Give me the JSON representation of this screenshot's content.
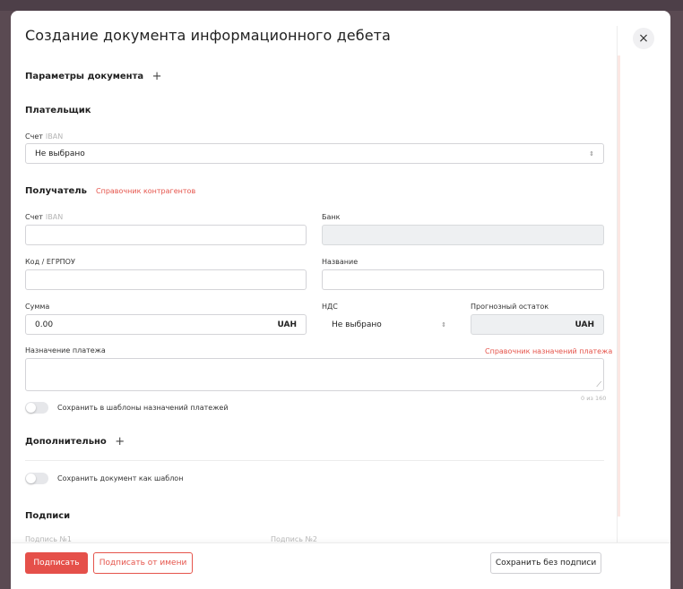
{
  "modal": {
    "title": "Создание документа информационного дебета",
    "close_label": "×"
  },
  "document_params": {
    "title": "Параметры документа",
    "plus": "+"
  },
  "payer": {
    "title": "Плательщик",
    "account_label": "Счет",
    "account_hint": "IBAN",
    "account_value": "Не выбрано",
    "sort_glyph": "⇕"
  },
  "recipient": {
    "title": "Получатель",
    "counterparty_link": "Справочник контрагентов",
    "account_label": "Счет",
    "account_hint": "IBAN",
    "bank_label": "Банк",
    "code_label": "Код / ЕГРПОУ",
    "name_label": "Название"
  },
  "amount": {
    "label": "Сумма",
    "value": "0.00",
    "currency": "UAH",
    "vat_label": "НДС",
    "vat_value": "Не выбрано",
    "forecast_label": "Прогнозный остаток",
    "forecast_currency": "UAH"
  },
  "purpose": {
    "label": "Назначение платежа",
    "directory_link": "Справочник назначений платежа",
    "counter": "0 из 160",
    "save_template_label": "Сохранить в шаблоны назначений платежей"
  },
  "additional": {
    "title": "Дополнительно",
    "plus": "+"
  },
  "save_document_template_label": "Сохранить документ как шаблон",
  "signatures": {
    "title": "Подписи",
    "sig1": "Подпись №1",
    "sig2": "Подпись №2"
  },
  "footer": {
    "sign_label": "Подписать",
    "sign_on_behalf_label": "Подписать от имени",
    "save_unsigned_label": "Сохранить без подписи"
  },
  "colors": {
    "accent": "#e5504a",
    "link": "#e5544b",
    "disabled_field": "#eef0f2"
  }
}
